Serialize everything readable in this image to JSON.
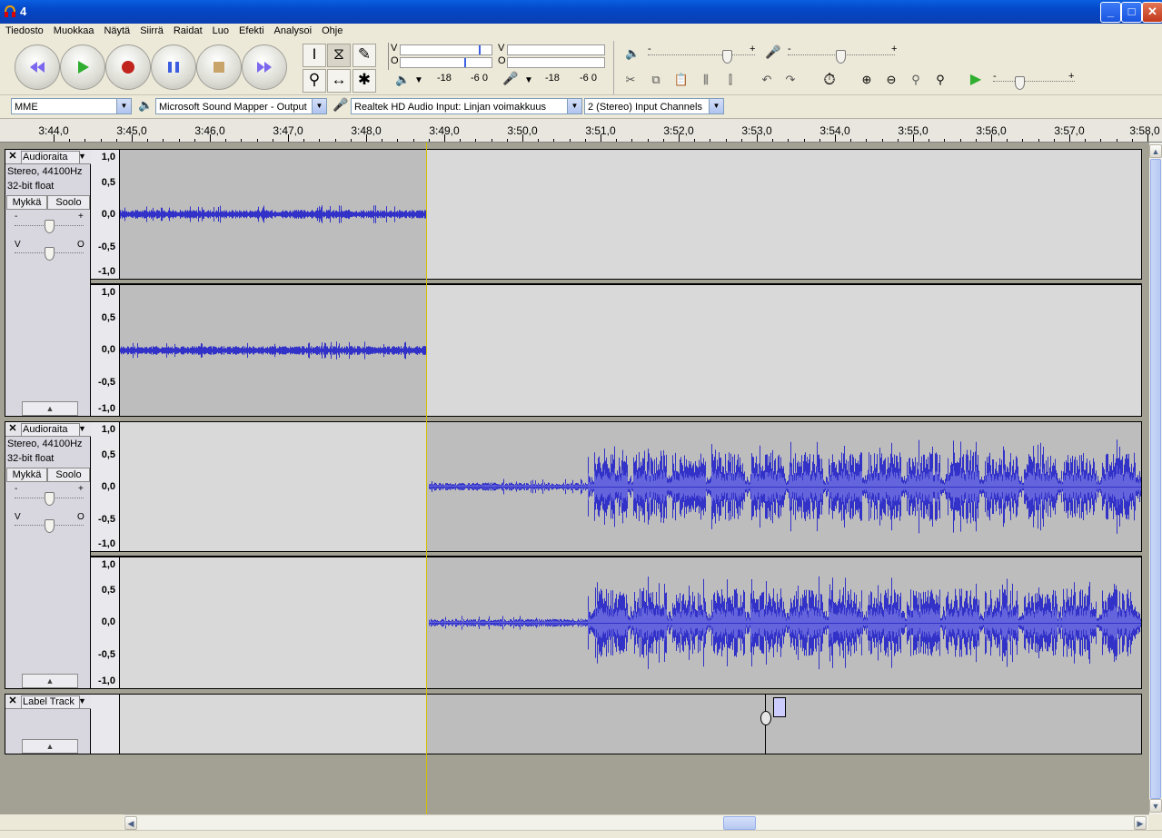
{
  "window": {
    "title": "4"
  },
  "menu": [
    "Tiedosto",
    "Muokkaa",
    "Näytä",
    "Siirrä",
    "Raidat",
    "Luo",
    "Efekti",
    "Analysoi",
    "Ohje"
  ],
  "meters": {
    "out_lr": [
      "V",
      "O"
    ],
    "in_lr": [
      "V",
      "O"
    ],
    "out_scale": [
      "-18",
      "-6 0"
    ],
    "in_scale": [
      "-18",
      "-6 0"
    ]
  },
  "mixer": {
    "minus": "-",
    "plus": "+"
  },
  "device": {
    "host": "MME",
    "output": "Microsoft Sound Mapper - Output",
    "input": "Realtek HD Audio Input: Linjan voimakkuus",
    "channels": "2 (Stereo) Input Channels"
  },
  "ruler": {
    "labels": [
      "3:44,0",
      "3:45,0",
      "3:46,0",
      "3:47,0",
      "3:48,0",
      "3:49,0",
      "3:50,0",
      "3:51,0",
      "3:52,0",
      "3:53,0",
      "3:54,0",
      "3:55,0",
      "3:56,0",
      "3:57,0",
      "3:58,0"
    ]
  },
  "tracks": [
    {
      "name": "Audioraita",
      "rate": "Stereo, 44100Hz",
      "format": "32-bit float",
      "mute": "Mykkä",
      "solo": "Soolo",
      "gain_minus": "-",
      "gain_plus": "+",
      "pan_left": "V",
      "pan_right": "O"
    },
    {
      "name": "Audioraita",
      "rate": "Stereo, 44100Hz",
      "format": "32-bit float",
      "mute": "Mykkä",
      "solo": "Soolo",
      "gain_minus": "-",
      "gain_plus": "+",
      "pan_left": "V",
      "pan_right": "O"
    }
  ],
  "label_track": {
    "name": "Label Track"
  },
  "vscale": [
    "1,0",
    "0,5",
    "0,0",
    "-0,5",
    "-1,0"
  ],
  "colors": {
    "waveform": "#3232c8",
    "waveform_rms": "#6464dc",
    "selection_bg": "#bdbdbd",
    "unselected_bg": "#d9d9d9",
    "cursor": "#d4c000"
  }
}
